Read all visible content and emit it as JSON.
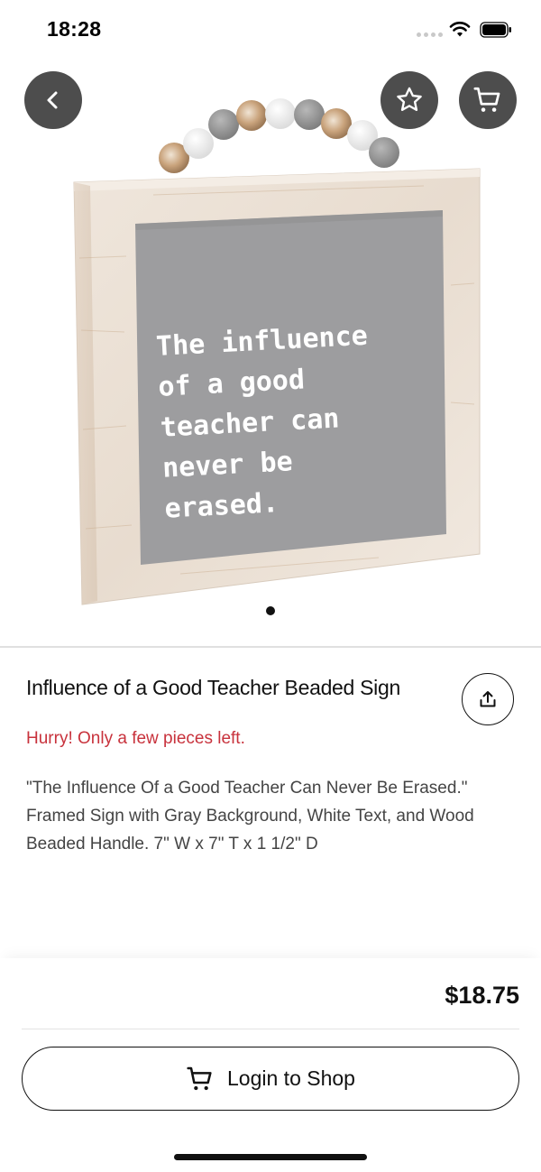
{
  "status_bar": {
    "time": "18:28"
  },
  "product": {
    "image_alt": "Framed sign with gray background, white text, and wood beaded handle",
    "sign_text": [
      "The influence",
      "of a good",
      "teacher can",
      "never be",
      "erased."
    ],
    "title": "Influence of a Good Teacher Beaded Sign",
    "stock_note": "Hurry! Only a few pieces left.",
    "description": "\"The Influence Of a Good Teacher Can Never Be Erased.\" Framed Sign with Gray Background, White Text, and Wood Beaded Handle.  7\" W x 7\" T x 1 1/2\" D",
    "price": "$18.75"
  },
  "actions": {
    "login_label": "Login to Shop"
  },
  "icons": {
    "back": "chevron-left-icon",
    "favorite": "star-icon",
    "cart": "cart-icon",
    "share": "share-icon"
  },
  "colors": {
    "accent_dark": "#4d4d4d",
    "stock_warning": "#c8323c"
  }
}
